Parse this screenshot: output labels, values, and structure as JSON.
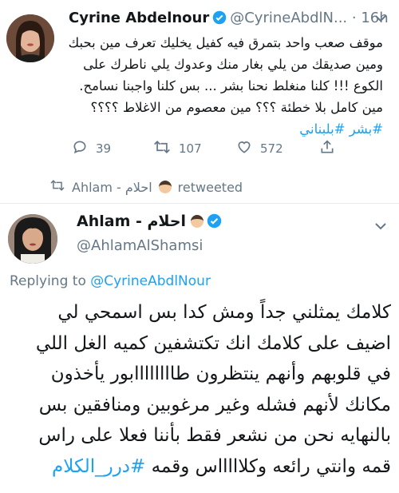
{
  "retweeted_tweet": {
    "author_name": "Cyrine Abdelnour",
    "author_handle": "@CyrineAbdlN...",
    "time": "· 16h",
    "text": "موقف صعب واحد بتمرق فيه كفيل يخليك تعرف مين بحبك ومين صديقك من يلي بغار منك وعدوك يلي ناطرك على الكوع !!! كلنا منغلط نحنا بشر ... بس كلنا واجبنا نسامح. مين كامل بلا خطئة ؟؟؟ مين معصوم من الاغلاط ؟؟؟؟",
    "hashtags": "#بشر #بلبناني",
    "replies": "39",
    "retweets": "107",
    "likes": "572"
  },
  "retweet_context": {
    "by": "Ahlam - احلام",
    "label": "retweeted"
  },
  "main_tweet": {
    "author_name": "Ahlam - احلام",
    "author_handle": "@AhlamAlShamsi",
    "replying_prefix": "Replying to",
    "replying_to": "@CyrineAbdlNour",
    "text": "كلامك يمثلني جداً ومش كدا بس اسمحي لي اضيف على كلامك انك تكتشفين كميه الغل اللي في قلوبهم وأنهم ينتظرون طاااااااابور يأخذون مكانك لأنهم فشله وغير مرغوبين ومنافقين بس بالنهايه نحن من نشعر فقط بأننا فعلا على راس قمه وانتي رائعه وكلاااااس وقمه",
    "hashtag": "#درر_الكلام"
  },
  "colors": {
    "link": "#1da1f2",
    "secondary_text": "#657786",
    "verified": "#1da1f2"
  }
}
